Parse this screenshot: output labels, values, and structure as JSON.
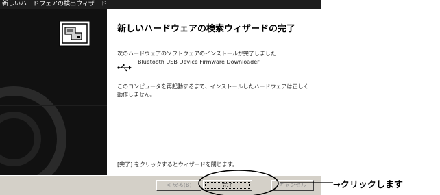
{
  "window": {
    "title": "新しいハードウェアの検出ウィザード"
  },
  "banner": {
    "icon": "hardware-wizard-icon"
  },
  "content": {
    "heading": "新しいハードウェアの検索ウィザードの完了",
    "installed_message": "次のハードウェアのソフトウェアのインストールが完了しました",
    "device_icon": "usb-icon",
    "device_name": "Bluetooth USB Device Firmware Downloader",
    "restart_message": "このコンピュータを再起動するまで、インストールしたハードウェアは正しく動作しません。",
    "close_message": "[完了] をクリックするとウィザードを閉じます。"
  },
  "buttons": {
    "back": "< 戻る(B)",
    "finish": "完了",
    "cancel": "キャンセル"
  },
  "annotation": {
    "callout_text": "→クリックします"
  }
}
